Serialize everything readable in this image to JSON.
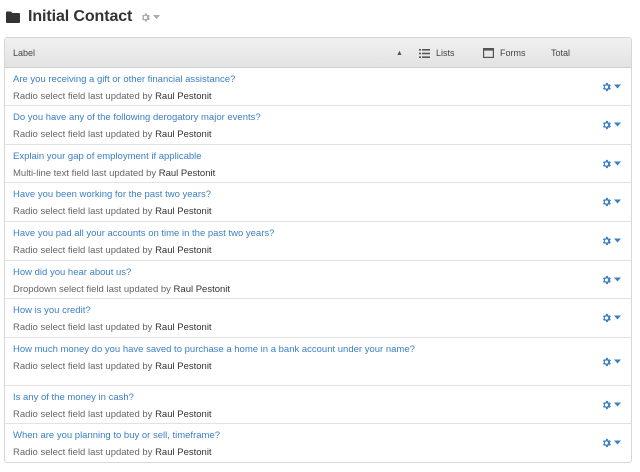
{
  "page": {
    "title": "Initial Contact"
  },
  "table": {
    "columns": {
      "label": "Label",
      "lists": "Lists",
      "forms": "Forms",
      "total": "Total"
    },
    "rows": [
      {
        "title": "Are you receiving a gift or other financial assistance?",
        "subtitle": "Radio select field last updated by",
        "updated_by": "Raul Pestonit"
      },
      {
        "title": "Do you have any of the following derogatory major events?",
        "subtitle": "Radio select field last updated by",
        "updated_by": "Raul Pestonit"
      },
      {
        "title": "Explain your gap of employment if applicable",
        "subtitle": "Multi-line text field last updated by",
        "updated_by": "Raul Pestonit"
      },
      {
        "title": "Have you been working for the past two years?",
        "subtitle": "Radio select field last updated by",
        "updated_by": "Raul Pestonit"
      },
      {
        "title": "Have you pad all your accounts on time in the past two years?",
        "subtitle": "Radio select field last updated by",
        "updated_by": "Raul Pestonit"
      },
      {
        "title": "How did you hear about us?",
        "subtitle": "Dropdown select field last updated by",
        "updated_by": "Raul Pestonit"
      },
      {
        "title": "How is you credit?",
        "subtitle": "Radio select field last updated by",
        "updated_by": "Raul Pestonit"
      },
      {
        "title": "How much money do you have saved to purchase a home in a bank account under your name?",
        "subtitle": "Radio select field last updated by",
        "updated_by": "Raul Pestonit"
      },
      {
        "title": "Is any of the money in cash?",
        "subtitle": "Radio select field last updated by",
        "updated_by": "Raul Pestonit"
      },
      {
        "title": "When are you planning to buy or sell, timeframe?",
        "subtitle": "Radio select field last updated by",
        "updated_by": "Raul Pestonit"
      }
    ]
  },
  "icons": {
    "folder": "folder-icon",
    "gear": "gear-icon",
    "caret": "caret-down-icon",
    "sort": "sort-up-icon",
    "list": "list-icon",
    "forms": "form-icon"
  },
  "colors": {
    "link": "#3b7fc4",
    "row_gear": "#3b7fc4",
    "header_gear": "#aaaaaa"
  }
}
